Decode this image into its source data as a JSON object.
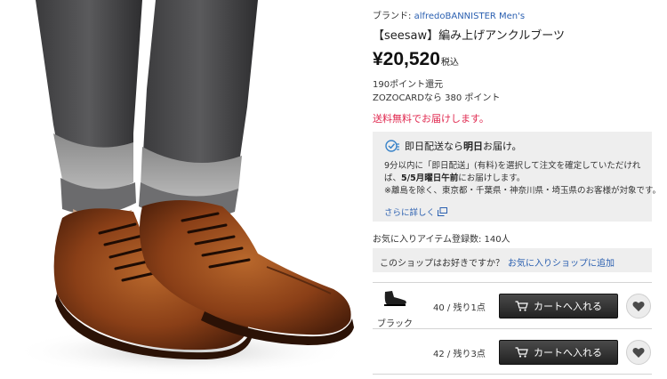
{
  "product": {
    "brand_prefix": "ブランド:",
    "brand_name": "alfredoBANNISTER Men's",
    "title": "【seesaw】編み上げアンクルブーツ",
    "price": "¥20,520",
    "tax_label": "税込",
    "points": "190ポイント還元",
    "zozocard_points": "ZOZOCARDなら 380 ポイント",
    "free_shipping": "送料無料でお届けします。"
  },
  "delivery": {
    "head_prefix": "即日配送なら",
    "head_bold": "明日",
    "head_suffix": "お届け。",
    "line1": "9分以内に「即日配送」(有料)を選択して注文を確定していただけれ",
    "line2_prefix": "ば、",
    "line2_bold": "5/5月曜日午前",
    "line2_suffix": "にお届けします。",
    "line3": "※離島を除く、東京都・千葉県・神奈川県・埼玉県のお客様が対象です。",
    "more_link": "さらに詳しく"
  },
  "favorites": {
    "count_text": "お気に入りアイテム登録数: 140人"
  },
  "shop": {
    "question": "このショップはお好きですか？",
    "add_link": "お気に入りショップに追加"
  },
  "variants": {
    "color": "ブラック",
    "rows": [
      {
        "size": "40 / 残り1点",
        "cart_label": "カートへ入れる"
      },
      {
        "size": "42 / 残り3点",
        "cart_label": "カートへ入れる"
      }
    ]
  },
  "colors": {
    "link": "#2a5fb0",
    "sale_red": "#e0284f",
    "panel_bg": "#eeeeee",
    "cart_button": "#222222"
  },
  "icons": {
    "delivery": "check-clock-icon",
    "external": "external-window-icon",
    "cart": "cart-icon",
    "favorite": "heart-icon"
  }
}
